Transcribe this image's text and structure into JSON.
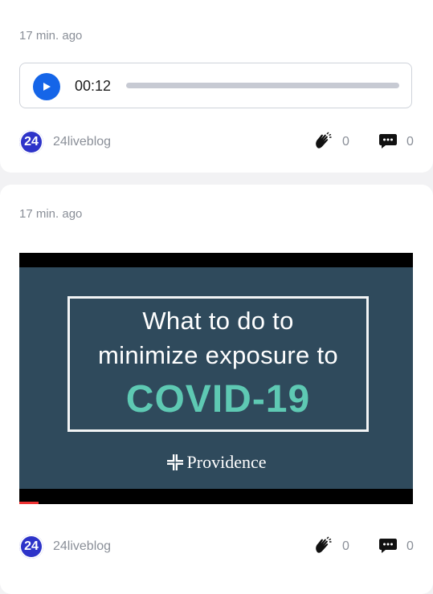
{
  "posts": [
    {
      "time": "17 min. ago",
      "audio": {
        "current_time": "00:12",
        "progress": 0.0
      },
      "author": "24liveblog",
      "avatar_text": "24",
      "claps": "0",
      "comments": "0"
    },
    {
      "time": "17 min. ago",
      "video": {
        "line1": "What to do to",
        "line2": "minimize exposure to",
        "line3": "COVID-19",
        "brand": "Providence",
        "progress": 0.05
      },
      "author": "24liveblog",
      "avatar_text": "24",
      "claps": "0",
      "comments": "0"
    }
  ],
  "colors": {
    "accent": "#1565e8",
    "avatar": "#2d33c9",
    "covid_text": "#5ec9b3",
    "video_bg": "#2f4a5c"
  },
  "icons": [
    "play-icon",
    "clap-icon",
    "comment-icon",
    "providence-cross-icon"
  ]
}
